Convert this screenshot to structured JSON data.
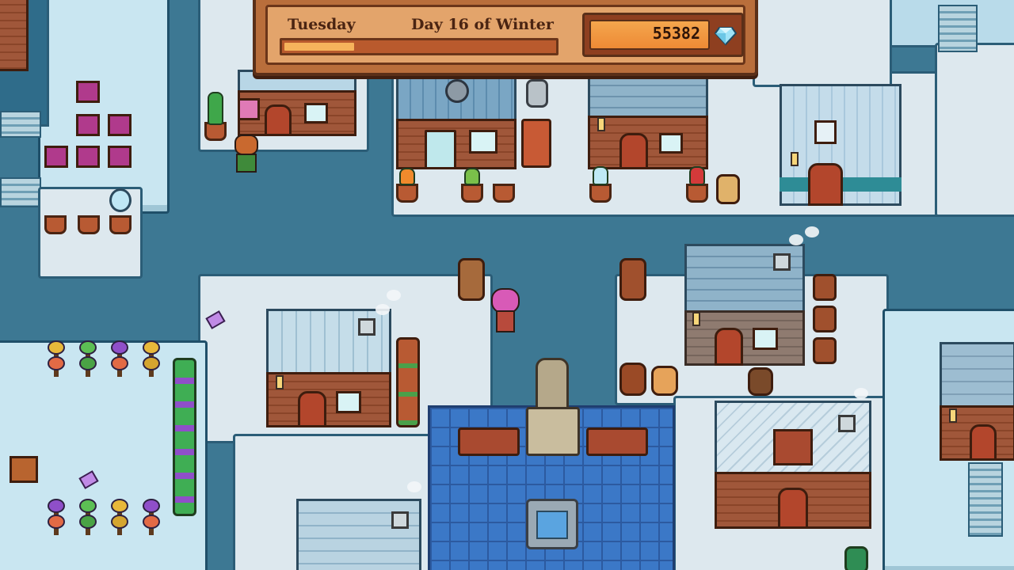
{
  "hud": {
    "weekday": "Tuesday",
    "date": "Day 16 of Winter",
    "money": "55382",
    "currency_icon": "diamond-gem-icon",
    "day_progress": 0.26
  },
  "colors": {
    "water": "#3d7893",
    "snow_ground": "#dde8ee",
    "hud_frame": "#b96e3b",
    "hud_text": "#4a2412",
    "money_fill": "#ee8a35",
    "player_hair": "#d85ab7"
  }
}
